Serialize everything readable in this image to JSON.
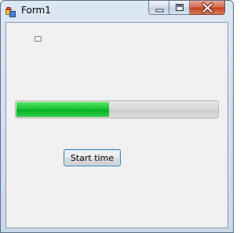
{
  "window": {
    "title": "Form1"
  },
  "icons": {
    "app": "form-icon",
    "minimize": "minimize-icon",
    "maximize": "maximize-icon",
    "close": "close-icon"
  },
  "progress": {
    "value_percent": 46,
    "fill_color": "#19c535"
  },
  "start_button": {
    "label": "Start time"
  }
}
